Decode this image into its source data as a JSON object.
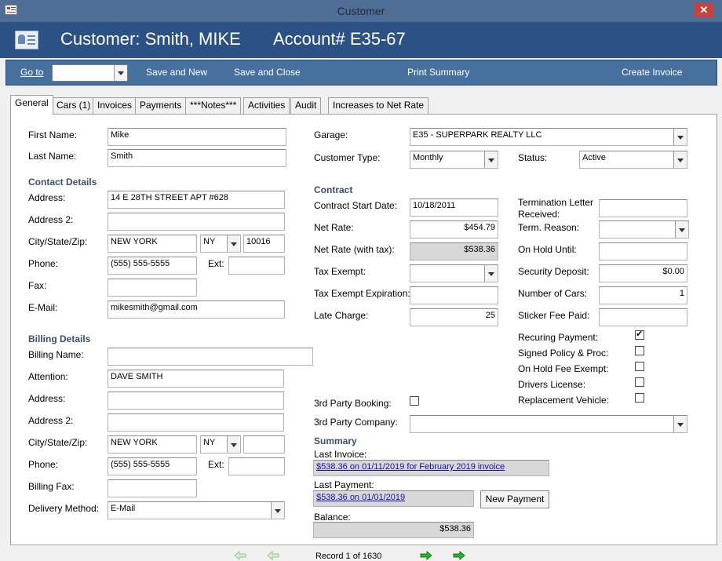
{
  "window": {
    "title": "Customer",
    "close_glyph": "✕"
  },
  "header": {
    "title": "Customer: Smith, MIKE",
    "account": "Account# E35-67",
    "icon": "form-icon"
  },
  "toolbar": {
    "goto_label": "Go to",
    "goto_value": "",
    "save_new": "Save and New",
    "save_close": "Save and Close",
    "print_summary": "Print Summary",
    "create_invoice": "Create Invoice"
  },
  "tabs": [
    "General",
    "Cars (1)",
    "Invoices",
    "Payments",
    "***Notes***",
    "Activities",
    "Audit",
    "Increases to Net Rate"
  ],
  "general": {
    "first_name_label": "First Name:",
    "first_name": "Mike",
    "last_name_label": "Last Name:",
    "last_name": "Smith",
    "contact_section": "Contact Details",
    "address_label": "Address:",
    "address": "14 E 28TH STREET APT #628",
    "address2_label": "Address 2:",
    "address2": "",
    "csz_label": "City/State/Zip:",
    "city": "NEW YORK",
    "state": "NY",
    "zip": "10016",
    "phone_label": "Phone:",
    "phone": "(555) 555-5555",
    "ext_label": "Ext:",
    "ext": "",
    "fax_label": "Fax:",
    "fax": "",
    "email_label": "E-Mail:",
    "email": "mikesmith@gmail.com",
    "billing_section": "Billing Details",
    "billing_name_label": "Billing Name:",
    "billing_name": "",
    "attention_label": "Attention:",
    "attention": "DAVE SMITH",
    "b_address_label": "Address:",
    "b_address": "",
    "b_address2_label": "Address 2:",
    "b_address2": "",
    "b_csz_label": "City/State/Zip:",
    "b_city": "NEW YORK",
    "b_state": "NY",
    "b_zip": "",
    "b_phone_label": "Phone:",
    "b_phone": "(555) 555-5555",
    "b_ext_label": "Ext:",
    "b_ext": "",
    "billing_fax_label": "Billing Fax:",
    "billing_fax": "",
    "delivery_label": "Delivery Method:",
    "delivery": "E-Mail",
    "garage_label": "Garage:",
    "garage": "E35 - SUPERPARK REALTY LLC",
    "customer_type_label": "Customer Type:",
    "customer_type": "Monthly",
    "status_label": "Status:",
    "status": "Active",
    "contract_section": "Contract",
    "start_date_label": "Contract Start Date:",
    "start_date": "10/18/2011",
    "net_rate_label": "Net Rate:",
    "net_rate": "$454.79",
    "net_rate_tax_label": "Net Rate (with tax):",
    "net_rate_tax": "$538.36",
    "tax_exempt_label": "Tax Exempt:",
    "tax_exempt": "",
    "tax_exempt_exp_label": "Tax Exempt Expiration:",
    "tax_exempt_exp": "",
    "late_charge_label": "Late Charge:",
    "late_charge": "25",
    "term_letter_label_1": "Termination Letter",
    "term_letter_label_2": "Received:",
    "term_letter": "",
    "term_reason_label": "Term. Reason:",
    "term_reason": "",
    "on_hold_until_label": "On Hold Until:",
    "on_hold_until": "",
    "security_deposit_label": "Security Deposit:",
    "security_deposit": "$0.00",
    "num_cars_label": "Number of Cars:",
    "num_cars": "1",
    "sticker_fee_label": "Sticker Fee Paid:",
    "sticker_fee": "",
    "recurring_label": "Recuring Payment:",
    "recurring": true,
    "signed_policy_label": "Signed Policy & Proc:",
    "signed_policy": false,
    "on_hold_fee_label": "On Hold Fee Exempt:",
    "on_hold_fee": false,
    "drivers_license_label": "Drivers License:",
    "drivers_license": false,
    "replacement_label": "Replacement Vehicle:",
    "replacement": false,
    "third_party_booking_label": "3rd Party Booking:",
    "third_party_booking": false,
    "third_party_company_label": "3rd Party Company:",
    "third_party_company": "",
    "summary_section": "Summary",
    "last_invoice_label": "Last Invoice:",
    "last_invoice": "$538.36 on 01/11/2019 for February 2019 invoice",
    "last_payment_label": "Last Payment:",
    "last_payment": "$538.36 on 01/01/2019",
    "new_payment": "New Payment",
    "balance_label": "Balance:",
    "balance": "$538.36"
  },
  "record_nav": {
    "text": "Record 1 of 1630"
  }
}
